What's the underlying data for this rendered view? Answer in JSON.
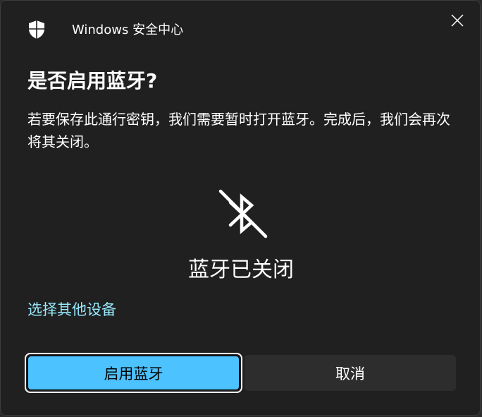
{
  "window": {
    "app_title": "Windows 安全中心",
    "app_icon": "shield-icon",
    "close_icon": "close-icon"
  },
  "dialog": {
    "heading": "是否启用蓝牙?",
    "message": "若要保存此通行密钥，我们需要暂时打开蓝牙。完成后，我们会再次将其关闭。",
    "status_icon": "bluetooth-off-icon",
    "status_text": "蓝牙已关闭",
    "other_device_link": "选择其他设备",
    "primary_button": "启用蓝牙",
    "secondary_button": "取消"
  },
  "colors": {
    "background": "#202020",
    "text": "#ffffff",
    "link": "#99ebff",
    "accent": "#4cc2ff",
    "secondary_button": "#2d2d2d"
  }
}
